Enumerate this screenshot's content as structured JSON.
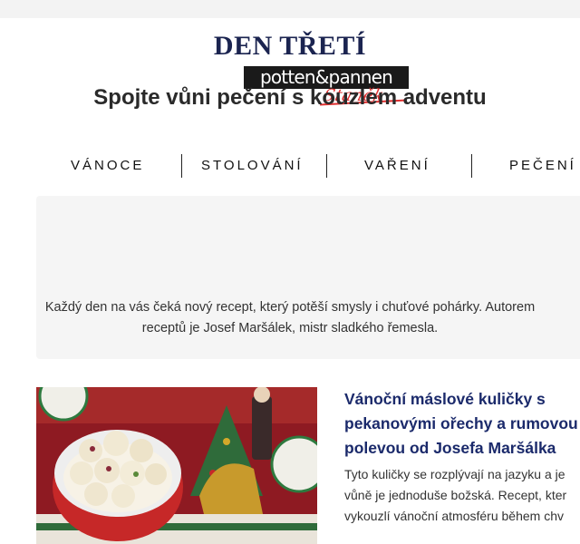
{
  "logo": {
    "brand": "potten&pannen",
    "script": "Staněk"
  },
  "nav": {
    "items": [
      {
        "label": "VÁNOCE"
      },
      {
        "label": "STOLOVÁNÍ"
      },
      {
        "label": "VAŘENÍ"
      },
      {
        "label": "PEČENÍ"
      }
    ]
  },
  "intro": {
    "title": "DEN TŘETÍ",
    "subtitle": "Spojte vůni pečení s kouzlem adventu",
    "description_lines": [
      "Každý den na vás čeká nový recept, který potěší smysly i chuťové pohárky. Autorem",
      "receptů je Josef Maršálek, mistr sladkého řemesla."
    ]
  },
  "article": {
    "image_alt": "vanocni-maslove-kulicky",
    "title_lines": [
      "Vánoční máslové kuličky s",
      "pekanovými ořechy a rumovou",
      "polevou od Josefa Maršálka"
    ],
    "text_lines": [
      "Tyto kuličky se rozplývají na jazyku a je",
      "vůně je jednoduše božská. Recept, kter",
      "vykouzlí vánoční atmosféru během chv"
    ]
  },
  "colors": {
    "accent": "#1b2a6b",
    "title": "#1b2450",
    "logo_red": "#e03030",
    "panel": "#f5f5f5"
  }
}
